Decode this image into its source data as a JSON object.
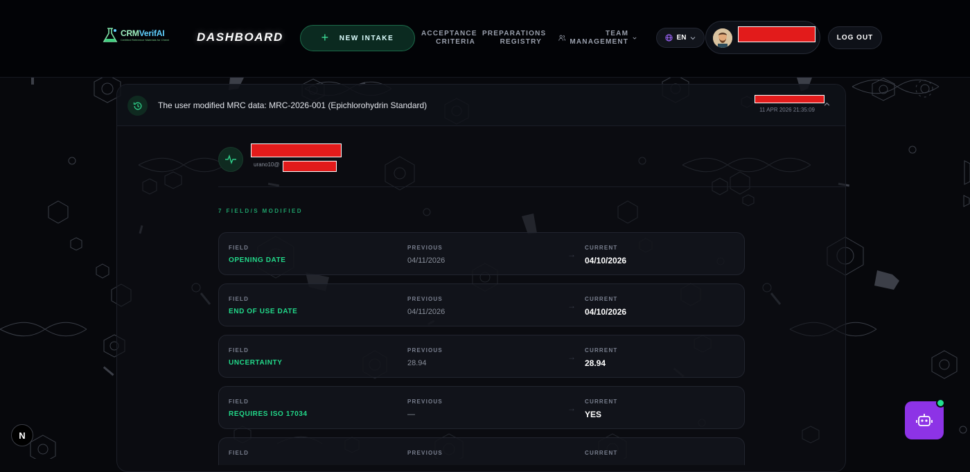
{
  "header": {
    "logo_text_a": "CRM",
    "logo_text_b": "VerifAI",
    "logo_subtitle": "Certified Reference Materials for Chemical Analysis",
    "title": "DASHBOARD",
    "new_intake_label": "NEW INTAKE",
    "nav": [
      {
        "line1": "ACCEPTANCE",
        "line2": "CRITERIA"
      },
      {
        "line1": "PREPARATIONS",
        "line2": "REGISTRY"
      },
      {
        "line1": "TEAM",
        "line2": "MANAGEMENT"
      }
    ],
    "language": "EN",
    "logout_label": "LOG OUT"
  },
  "event": {
    "description": "The user modified MRC data: MRC-2026-001 (Epichlorohydrin Standard)",
    "timestamp": "11 APR 2026 21:35:09",
    "actor_email_prefix": "urano10@",
    "fields_modified_label": "7 FIELD/S MODIFIED",
    "column_labels": {
      "field": "FIELD",
      "previous": "PREVIOUS",
      "current": "CURRENT"
    },
    "changes": [
      {
        "field": "OPENING DATE",
        "previous": "04/11/2026",
        "current": "04/10/2026"
      },
      {
        "field": "END OF USE DATE",
        "previous": "04/11/2026",
        "current": "04/10/2026"
      },
      {
        "field": "UNCERTAINTY",
        "previous": "28.94",
        "current": "28.94"
      },
      {
        "field": "REQUIRES ISO 17034",
        "previous": "—",
        "current": "YES"
      },
      {
        "field": "",
        "previous": "",
        "current": ""
      }
    ]
  },
  "dev_badge": "N",
  "colors": {
    "accent": "#22d98a",
    "background": "#07080c",
    "redaction": "#e21b1b",
    "assistant": "#8d33e6"
  }
}
